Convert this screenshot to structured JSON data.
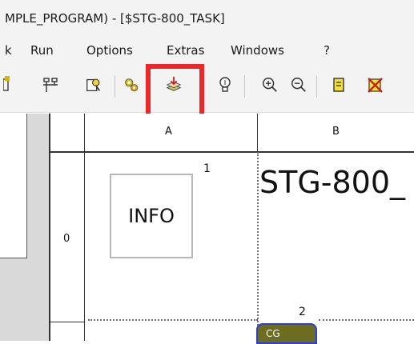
{
  "window": {
    "title": "MPLE_PROGRAM)  - [$STG-800_TASK]"
  },
  "menu": {
    "items": [
      "k",
      "Run",
      "Options",
      "Extras",
      "Windows",
      "?"
    ]
  },
  "toolbar": {
    "buttons": [
      "partial-tool-icon",
      "network-icon",
      "find-icon",
      "gears-icon",
      "download-stack-icon",
      "bulb-icon",
      "zoom-in-icon",
      "zoom-out-icon",
      "yellow-list-icon",
      "delete-red-icon"
    ],
    "highlighted": "download-stack-icon",
    "highlight_color": "#e8282b"
  },
  "grid": {
    "columns": [
      "A",
      "B"
    ],
    "rows": [
      "0"
    ]
  },
  "editor": {
    "info_label": "INFO",
    "title_text": "STG-800_",
    "network_numbers": [
      "1",
      "2"
    ],
    "block_label": "CG"
  }
}
